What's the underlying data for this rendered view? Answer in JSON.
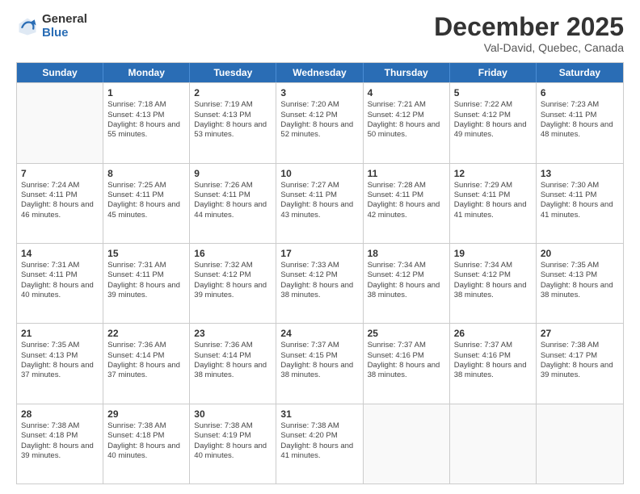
{
  "logo": {
    "general": "General",
    "blue": "Blue"
  },
  "header": {
    "month": "December 2025",
    "location": "Val-David, Quebec, Canada"
  },
  "days": [
    "Sunday",
    "Monday",
    "Tuesday",
    "Wednesday",
    "Thursday",
    "Friday",
    "Saturday"
  ],
  "weeks": [
    [
      {
        "day": "",
        "sunrise": "",
        "sunset": "",
        "daylight": ""
      },
      {
        "day": "1",
        "sunrise": "Sunrise: 7:18 AM",
        "sunset": "Sunset: 4:13 PM",
        "daylight": "Daylight: 8 hours and 55 minutes."
      },
      {
        "day": "2",
        "sunrise": "Sunrise: 7:19 AM",
        "sunset": "Sunset: 4:13 PM",
        "daylight": "Daylight: 8 hours and 53 minutes."
      },
      {
        "day": "3",
        "sunrise": "Sunrise: 7:20 AM",
        "sunset": "Sunset: 4:12 PM",
        "daylight": "Daylight: 8 hours and 52 minutes."
      },
      {
        "day": "4",
        "sunrise": "Sunrise: 7:21 AM",
        "sunset": "Sunset: 4:12 PM",
        "daylight": "Daylight: 8 hours and 50 minutes."
      },
      {
        "day": "5",
        "sunrise": "Sunrise: 7:22 AM",
        "sunset": "Sunset: 4:12 PM",
        "daylight": "Daylight: 8 hours and 49 minutes."
      },
      {
        "day": "6",
        "sunrise": "Sunrise: 7:23 AM",
        "sunset": "Sunset: 4:11 PM",
        "daylight": "Daylight: 8 hours and 48 minutes."
      }
    ],
    [
      {
        "day": "7",
        "sunrise": "Sunrise: 7:24 AM",
        "sunset": "Sunset: 4:11 PM",
        "daylight": "Daylight: 8 hours and 46 minutes."
      },
      {
        "day": "8",
        "sunrise": "Sunrise: 7:25 AM",
        "sunset": "Sunset: 4:11 PM",
        "daylight": "Daylight: 8 hours and 45 minutes."
      },
      {
        "day": "9",
        "sunrise": "Sunrise: 7:26 AM",
        "sunset": "Sunset: 4:11 PM",
        "daylight": "Daylight: 8 hours and 44 minutes."
      },
      {
        "day": "10",
        "sunrise": "Sunrise: 7:27 AM",
        "sunset": "Sunset: 4:11 PM",
        "daylight": "Daylight: 8 hours and 43 minutes."
      },
      {
        "day": "11",
        "sunrise": "Sunrise: 7:28 AM",
        "sunset": "Sunset: 4:11 PM",
        "daylight": "Daylight: 8 hours and 42 minutes."
      },
      {
        "day": "12",
        "sunrise": "Sunrise: 7:29 AM",
        "sunset": "Sunset: 4:11 PM",
        "daylight": "Daylight: 8 hours and 41 minutes."
      },
      {
        "day": "13",
        "sunrise": "Sunrise: 7:30 AM",
        "sunset": "Sunset: 4:11 PM",
        "daylight": "Daylight: 8 hours and 41 minutes."
      }
    ],
    [
      {
        "day": "14",
        "sunrise": "Sunrise: 7:31 AM",
        "sunset": "Sunset: 4:11 PM",
        "daylight": "Daylight: 8 hours and 40 minutes."
      },
      {
        "day": "15",
        "sunrise": "Sunrise: 7:31 AM",
        "sunset": "Sunset: 4:11 PM",
        "daylight": "Daylight: 8 hours and 39 minutes."
      },
      {
        "day": "16",
        "sunrise": "Sunrise: 7:32 AM",
        "sunset": "Sunset: 4:12 PM",
        "daylight": "Daylight: 8 hours and 39 minutes."
      },
      {
        "day": "17",
        "sunrise": "Sunrise: 7:33 AM",
        "sunset": "Sunset: 4:12 PM",
        "daylight": "Daylight: 8 hours and 38 minutes."
      },
      {
        "day": "18",
        "sunrise": "Sunrise: 7:34 AM",
        "sunset": "Sunset: 4:12 PM",
        "daylight": "Daylight: 8 hours and 38 minutes."
      },
      {
        "day": "19",
        "sunrise": "Sunrise: 7:34 AM",
        "sunset": "Sunset: 4:12 PM",
        "daylight": "Daylight: 8 hours and 38 minutes."
      },
      {
        "day": "20",
        "sunrise": "Sunrise: 7:35 AM",
        "sunset": "Sunset: 4:13 PM",
        "daylight": "Daylight: 8 hours and 38 minutes."
      }
    ],
    [
      {
        "day": "21",
        "sunrise": "Sunrise: 7:35 AM",
        "sunset": "Sunset: 4:13 PM",
        "daylight": "Daylight: 8 hours and 37 minutes."
      },
      {
        "day": "22",
        "sunrise": "Sunrise: 7:36 AM",
        "sunset": "Sunset: 4:14 PM",
        "daylight": "Daylight: 8 hours and 37 minutes."
      },
      {
        "day": "23",
        "sunrise": "Sunrise: 7:36 AM",
        "sunset": "Sunset: 4:14 PM",
        "daylight": "Daylight: 8 hours and 38 minutes."
      },
      {
        "day": "24",
        "sunrise": "Sunrise: 7:37 AM",
        "sunset": "Sunset: 4:15 PM",
        "daylight": "Daylight: 8 hours and 38 minutes."
      },
      {
        "day": "25",
        "sunrise": "Sunrise: 7:37 AM",
        "sunset": "Sunset: 4:16 PM",
        "daylight": "Daylight: 8 hours and 38 minutes."
      },
      {
        "day": "26",
        "sunrise": "Sunrise: 7:37 AM",
        "sunset": "Sunset: 4:16 PM",
        "daylight": "Daylight: 8 hours and 38 minutes."
      },
      {
        "day": "27",
        "sunrise": "Sunrise: 7:38 AM",
        "sunset": "Sunset: 4:17 PM",
        "daylight": "Daylight: 8 hours and 39 minutes."
      }
    ],
    [
      {
        "day": "28",
        "sunrise": "Sunrise: 7:38 AM",
        "sunset": "Sunset: 4:18 PM",
        "daylight": "Daylight: 8 hours and 39 minutes."
      },
      {
        "day": "29",
        "sunrise": "Sunrise: 7:38 AM",
        "sunset": "Sunset: 4:18 PM",
        "daylight": "Daylight: 8 hours and 40 minutes."
      },
      {
        "day": "30",
        "sunrise": "Sunrise: 7:38 AM",
        "sunset": "Sunset: 4:19 PM",
        "daylight": "Daylight: 8 hours and 40 minutes."
      },
      {
        "day": "31",
        "sunrise": "Sunrise: 7:38 AM",
        "sunset": "Sunset: 4:20 PM",
        "daylight": "Daylight: 8 hours and 41 minutes."
      },
      {
        "day": "",
        "sunrise": "",
        "sunset": "",
        "daylight": ""
      },
      {
        "day": "",
        "sunrise": "",
        "sunset": "",
        "daylight": ""
      },
      {
        "day": "",
        "sunrise": "",
        "sunset": "",
        "daylight": ""
      }
    ]
  ]
}
